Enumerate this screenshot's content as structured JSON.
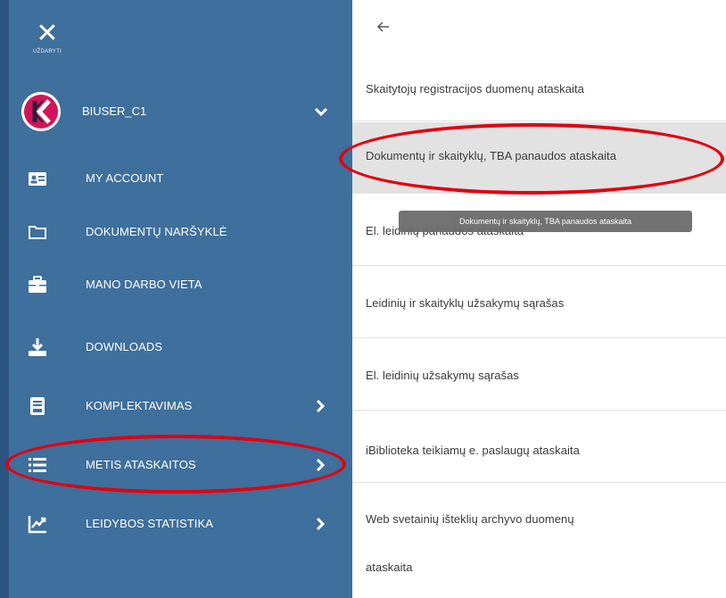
{
  "sidebar": {
    "close_label": "UŽDARYTI",
    "user": {
      "name": "BIUSER_C1",
      "avatar_letter": "K"
    },
    "items": [
      {
        "label": "MY ACCOUNT",
        "icon": "id-card-icon",
        "has_arrow": false
      },
      {
        "label": "DOKUMENTŲ NARŠYKLĖ",
        "icon": "folder-icon",
        "has_arrow": false
      },
      {
        "label": "MANO DARBO VIETA",
        "icon": "briefcase-icon",
        "has_arrow": false
      },
      {
        "label": "DOWNLOADS",
        "icon": "download-icon",
        "has_arrow": false
      },
      {
        "label": "KOMPLEKTAVIMAS",
        "icon": "book-icon",
        "has_arrow": true
      },
      {
        "label": "METIS ATASKAITOS",
        "icon": "list-icon",
        "has_arrow": true
      },
      {
        "label": "LEIDYBOS STATISTIKA",
        "icon": "chart-icon",
        "has_arrow": true
      }
    ]
  },
  "panel": {
    "reports": [
      "Skaitytojų registracijos duomenų ataskaita",
      "Dokumentų ir skaityklų, TBA panaudos ataskaita",
      "El. leidinių panaudos ataskaita",
      "Leidinių ir skaityklų užsakymų sąrašas",
      "El. leidinių užsakymų sąrašas",
      "iBiblioteka teikiamų e. paslaugų ataskaita",
      "Web svetainių išteklių archyvo duomenų",
      "ataskaita"
    ],
    "tooltip": "Dokumentų ir skaityklų, TBA panaudos ataskaita"
  },
  "colors": {
    "sidebar_bg": "#3f6f9c",
    "panel_bg": "#ffffff",
    "active_row_bg": "#e2e2e2",
    "annotation_red": "#e3000f",
    "avatar_brand": "#d4145a"
  }
}
